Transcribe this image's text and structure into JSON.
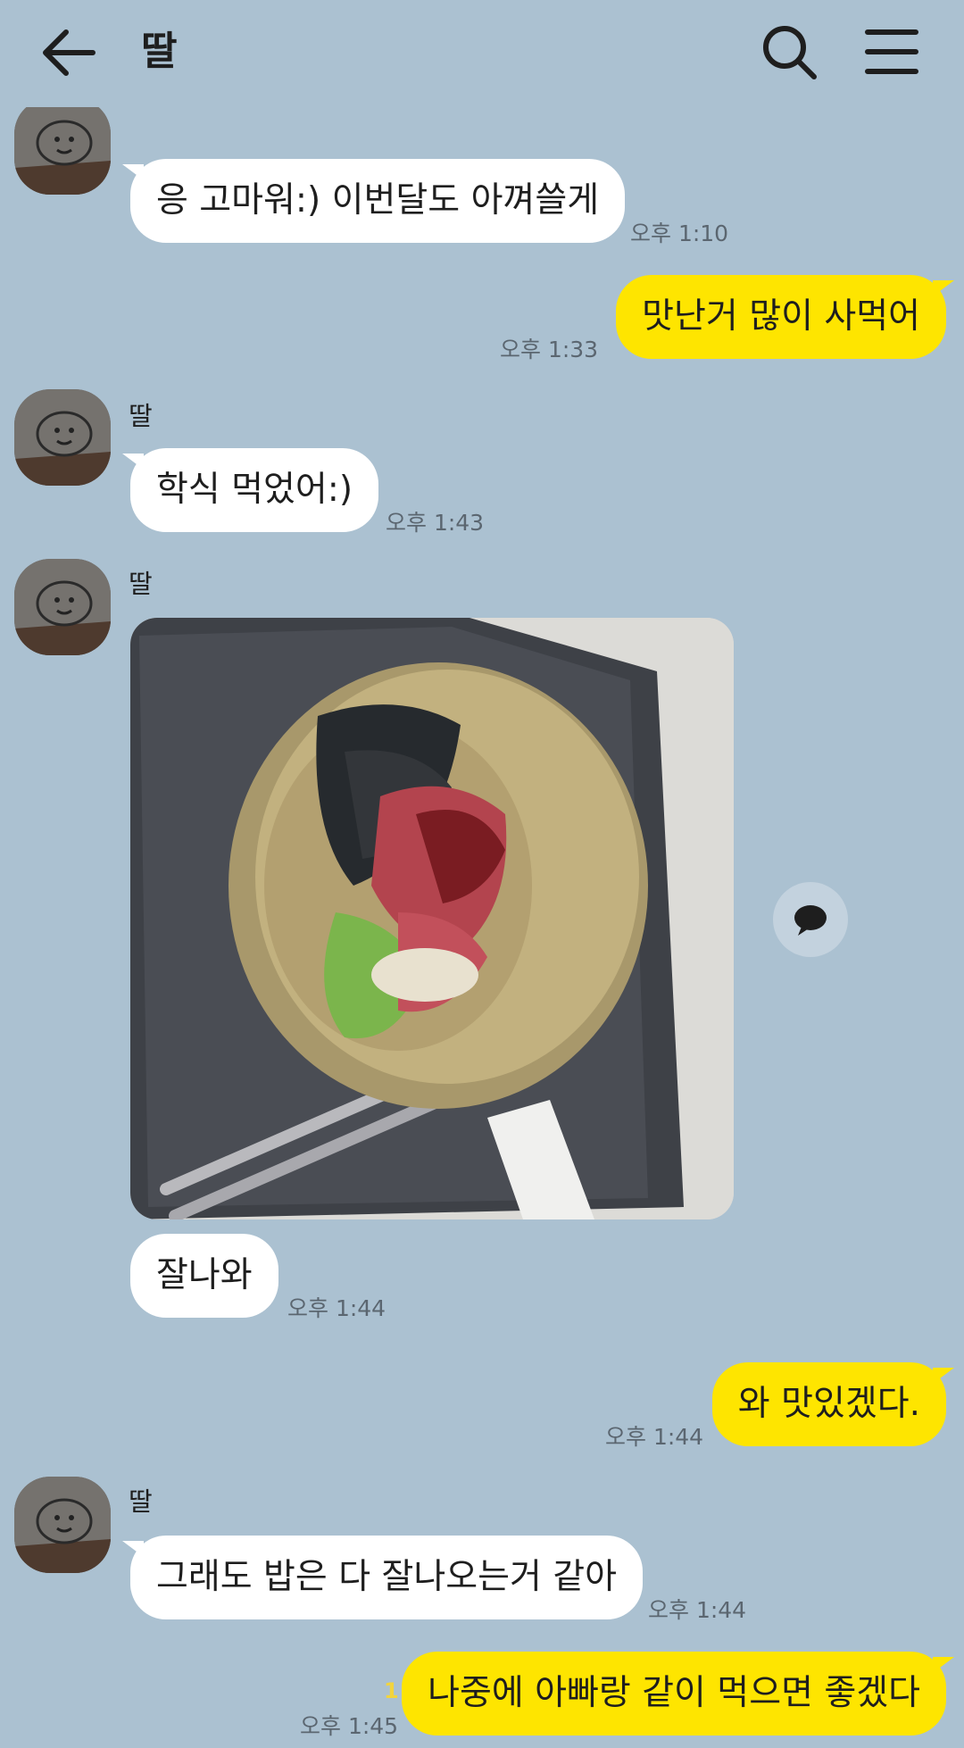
{
  "header": {
    "title": "딸",
    "back_icon": "arrow-left-icon",
    "search_icon": "search-icon",
    "menu_icon": "hamburger-menu-icon"
  },
  "colors": {
    "background": "#abc1d1",
    "incoming_bubble": "#ffffff",
    "outgoing_bubble": "#fee500"
  },
  "messages": [
    {
      "sender": "딸",
      "text": "응 고마워:) 이번달도 아껴쓸게",
      "time": "오후 1:10"
    },
    {
      "text": "맛난거  많이 사먹어",
      "time": "오후 1:33"
    },
    {
      "sender": "딸",
      "text": "학식 먹었어:)",
      "time": "오후 1:43"
    },
    {
      "sender": "딸",
      "image": "photo-bibimbap-bowl-on-tray",
      "share_icon": "chat-bubble-icon"
    },
    {
      "text": "잘나와",
      "time": "오후 1:44"
    },
    {
      "text": "와 맛있겠다.",
      "time": "오후 1:44"
    },
    {
      "sender": "딸",
      "text": "그래도 밥은 다 잘나오는거 같아",
      "time": "오후 1:44"
    },
    {
      "text": "나중에 아빠랑 같이 먹으면 좋겠다",
      "time": "오후 1:45",
      "unread": "1"
    }
  ]
}
